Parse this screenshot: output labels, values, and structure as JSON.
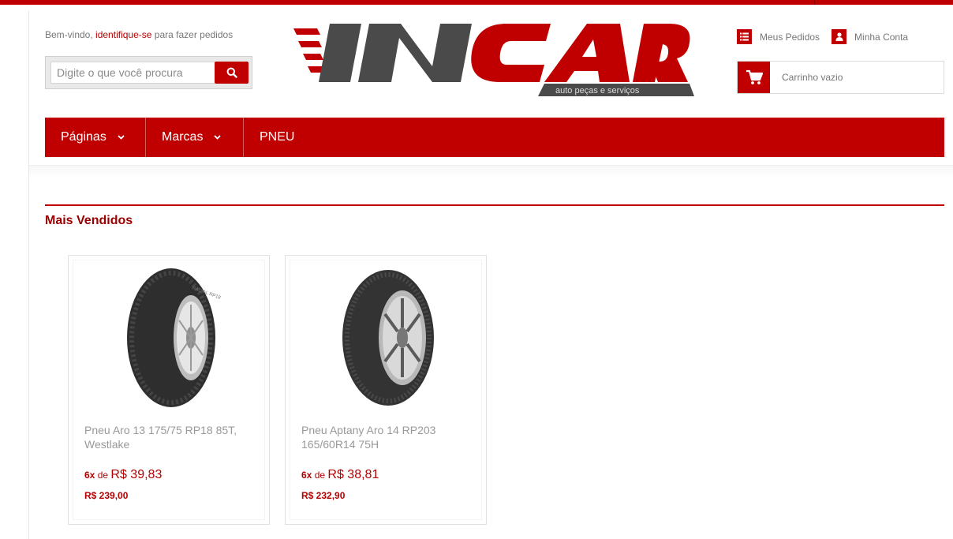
{
  "header": {
    "welcome_prefix": "Bem-vindo,",
    "login_link": "identifique-se",
    "welcome_suffix": "para fazer pedidos",
    "search_placeholder": "Digite o que você procura",
    "links": {
      "orders": "Meus Pedidos",
      "account": "Minha Conta"
    },
    "cart_text": "Carrinho vazio"
  },
  "logo": {
    "brand": "INCAR",
    "tagline": "auto peças e serviços"
  },
  "nav": {
    "items": [
      {
        "label": "Páginas",
        "dropdown": true
      },
      {
        "label": "Marcas",
        "dropdown": true
      },
      {
        "label": "PNEU",
        "dropdown": false
      }
    ]
  },
  "section": {
    "title": "Mais Vendidos"
  },
  "products": [
    {
      "name": "Pneu Aro 13 175/75 RP18 85T, Westlake",
      "installments_count": "6x",
      "installments_of": "de",
      "installment_price": "R$ 39,83",
      "total_price": "R$ 239,00"
    },
    {
      "name": "Pneu Aptany Aro 14 RP203 165/60R14 75H",
      "installments_count": "6x",
      "installments_of": "de",
      "installment_price": "R$ 38,81",
      "total_price": "R$ 232,90"
    }
  ],
  "colors": {
    "brand_red": "#c00000",
    "logo_gray": "#4a4a4a",
    "price_red": "#b40000"
  },
  "icons": {
    "search": "search-icon",
    "orders": "list-icon",
    "account": "user-icon",
    "cart": "cart-icon",
    "dropdown": "chevron-down-icon"
  }
}
